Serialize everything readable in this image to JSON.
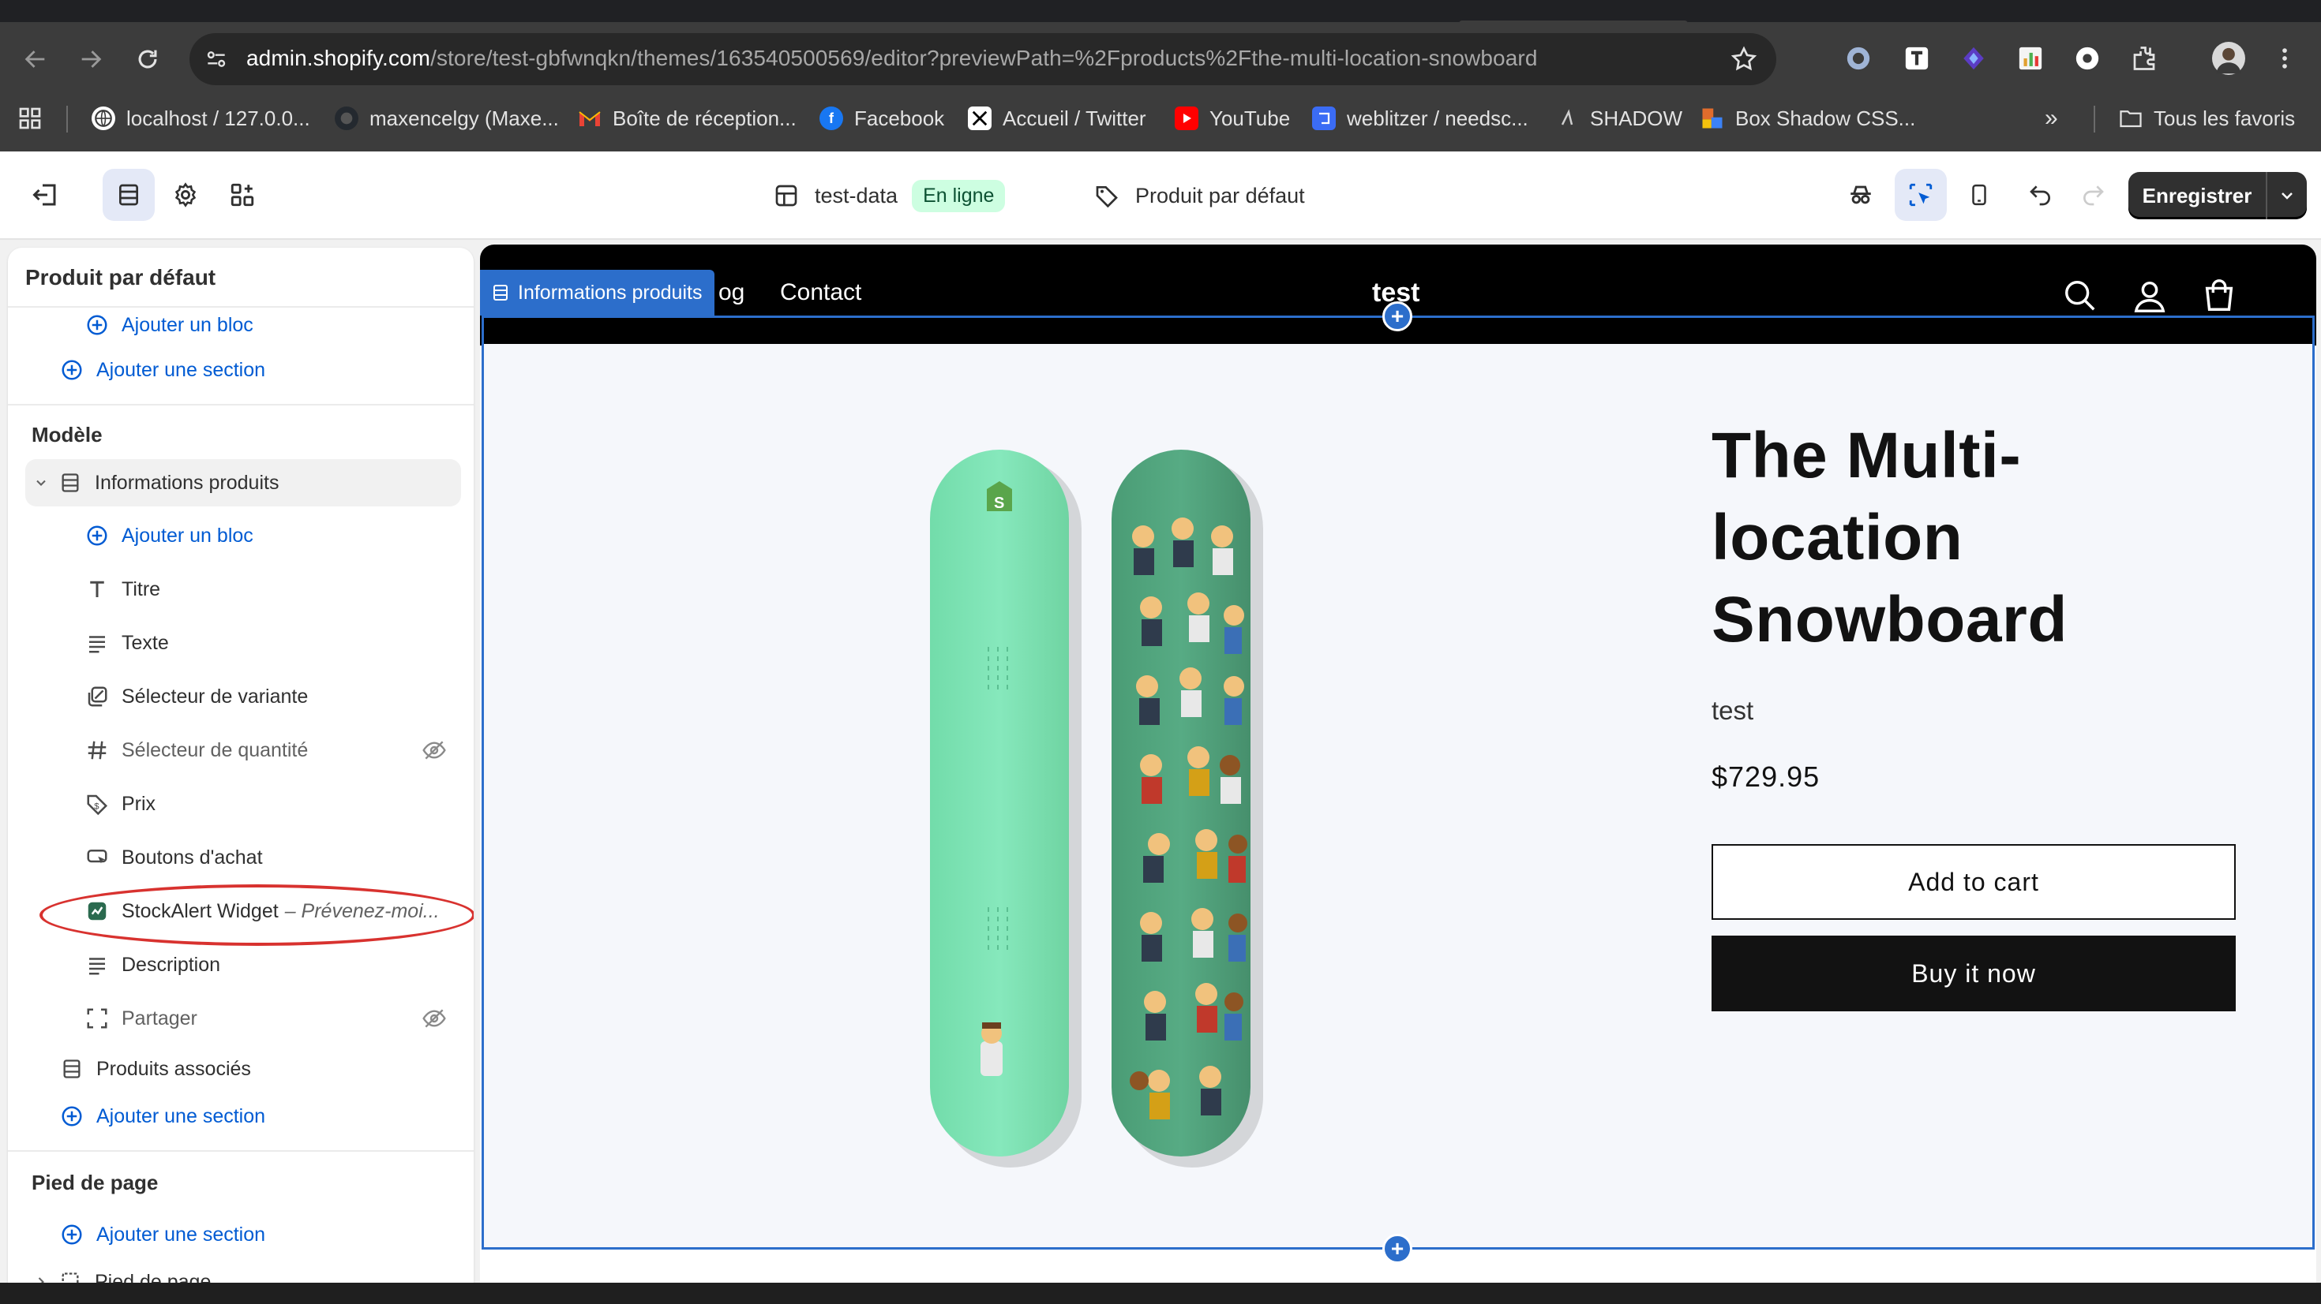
{
  "browser": {
    "url_host": "admin.shopify.com",
    "url_path": "/store/test-gbfwnqkn/themes/163540500569/editor?previewPath=%2Fproducts%2Fthe-multi-location-snowboard",
    "bookmarks": [
      {
        "label": "localhost / 127.0.0...",
        "icon": "globe-icon",
        "color": "#5f6368"
      },
      {
        "label": "maxencelgy (Maxe...",
        "icon": "github-icon",
        "color": "#24292f"
      },
      {
        "label": "Boîte de réception...",
        "icon": "gmail-icon",
        "color": "#ea4335"
      },
      {
        "label": "Facebook",
        "icon": "facebook-icon",
        "color": "#1877f2"
      },
      {
        "label": "Accueil / Twitter",
        "icon": "x-icon",
        "color": "#000000"
      },
      {
        "label": "YouTube",
        "icon": "youtube-icon",
        "color": "#ff0000"
      },
      {
        "label": "weblitzer / needsc...",
        "icon": "weblitzer-icon",
        "color": "#3b6cf5"
      },
      {
        "label": "SHADOW",
        "icon": "shadow-icon",
        "color": "#2e2e2e"
      },
      {
        "label": "Box Shadow CSS...",
        "icon": "boxshadow-icon",
        "color": "#e06c2c"
      }
    ],
    "all_bookmarks_label": "Tous les favoris",
    "overflow_label": "»"
  },
  "editor": {
    "theme_name": "test-data",
    "status_badge": "En ligne",
    "template_name": "Produit par défaut",
    "save_label": "Enregistrer"
  },
  "sidebar": {
    "title": "Produit par défaut",
    "add_block_top": "Ajouter un bloc",
    "add_section_top": "Ajouter une section",
    "template_group": "Modèle",
    "section_name": "Informations produits",
    "add_block": "Ajouter un bloc",
    "blocks": [
      {
        "label": "Titre",
        "icon": "text-type-icon",
        "hidden": false
      },
      {
        "label": "Texte",
        "icon": "text-lines-icon",
        "hidden": false
      },
      {
        "label": "Sélecteur de variante",
        "icon": "variant-picker-icon",
        "hidden": false
      },
      {
        "label": "Sélecteur de quantité",
        "icon": "hashtag-icon",
        "hidden": true
      },
      {
        "label": "Prix",
        "icon": "price-tag-icon",
        "hidden": false
      },
      {
        "label": "Boutons d'achat",
        "icon": "buy-buttons-icon",
        "hidden": false
      },
      {
        "label": "StockAlert Widget",
        "subtitle": "– Prévenez-moi...",
        "icon": "app-block-icon",
        "hidden": false
      },
      {
        "label": "Description",
        "icon": "text-lines-icon",
        "hidden": false
      },
      {
        "label": "Partager",
        "icon": "share-frame-icon",
        "hidden": true
      }
    ],
    "related_section": "Produits associés",
    "add_section": "Ajouter une section",
    "footer_group": "Pied de page",
    "footer_add_section": "Ajouter une section",
    "footer_item": "Pied de page"
  },
  "preview": {
    "section_label": "Informations produits",
    "nav_partial": "og",
    "nav_contact": "Contact",
    "store_name": "test",
    "product_title": "The Multi-location Snowboard",
    "vendor": "test",
    "price": "$729.95",
    "add_to_cart": "Add to cart",
    "buy_now": "Buy it now"
  },
  "colors": {
    "accent_blue": "#2c6ecb",
    "link_blue": "#005bd3",
    "online_badge": "#cdfee1",
    "annotation_red": "#d8322f",
    "snowboard_mint": "#7fe3b4",
    "snowboard_green": "#4fa27b"
  }
}
